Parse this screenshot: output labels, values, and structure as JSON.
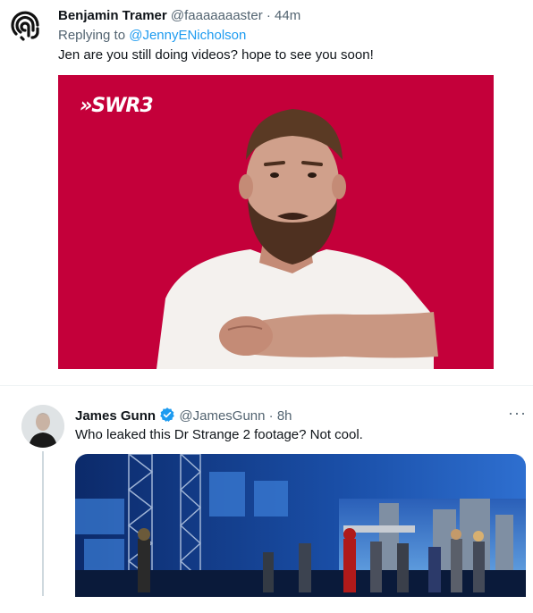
{
  "tweet1": {
    "display_name": "Benjamin Tramer",
    "handle": "@faaaaaaaster",
    "separator": "·",
    "time": "44m",
    "replying_prefix": "Replying to ",
    "replying_to": "@JennyENicholson",
    "text": "Jen are you still doing videos?  hope to see you soon!",
    "media": {
      "logo": "»SWR3",
      "background": "#c4003a"
    }
  },
  "tweet2": {
    "display_name": "James Gunn",
    "verified_icon": "verified-badge-icon",
    "handle": "@JamesGunn",
    "separator": "·",
    "time": "8h",
    "more_label": "···",
    "text": "Who leaked this Dr Strange 2 footage? Not cool."
  },
  "colors": {
    "accent": "#1d9bf0",
    "secondary_text": "#536471"
  }
}
